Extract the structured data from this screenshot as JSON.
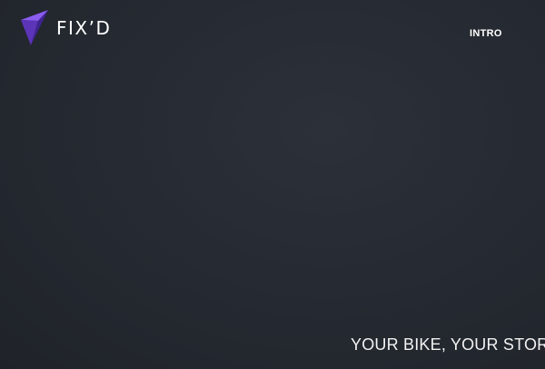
{
  "header": {
    "logo": {
      "text": "FIX’D",
      "icon": "arrow-cursor-logo-icon",
      "colors": {
        "mark_light": "#8a5cf0",
        "mark_dark": "#4a2a9a"
      }
    },
    "nav": {
      "items": [
        {
          "label": "INTRO"
        }
      ]
    }
  },
  "hero": {
    "tagline": "YOUR BIKE, YOUR STOR"
  },
  "colors": {
    "background": "#262a32",
    "text": "#ffffff"
  }
}
